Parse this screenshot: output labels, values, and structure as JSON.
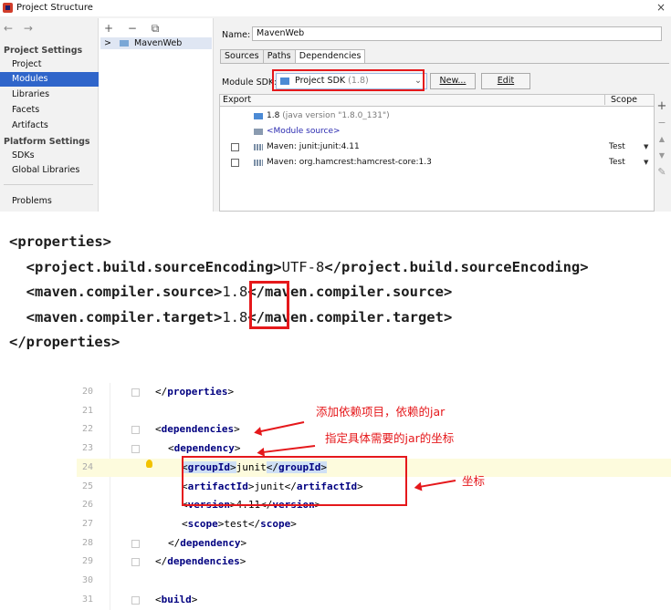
{
  "dialog": {
    "title": "Project Structure",
    "close_glyph": "×",
    "nav_arrows": "← →",
    "nav": {
      "project_settings_header": "Project Settings",
      "items_project": [
        "Project",
        "Modules",
        "Libraries",
        "Facets",
        "Artifacts"
      ],
      "platform_settings_header": "Platform Settings",
      "items_platform": [
        "SDKs",
        "Global Libraries"
      ],
      "problems": "Problems",
      "selected": "Modules"
    },
    "mid": {
      "toolbar": "+ − ⧉",
      "module_name": "MavenWeb",
      "expander": ">"
    },
    "name_label": "Name:",
    "name_value": "MavenWeb",
    "tabs": [
      "Sources",
      "Paths",
      "Dependencies"
    ],
    "active_tab": "Dependencies",
    "module_sdk_label": "Module SDK:",
    "sdk_selected": "Project SDK",
    "sdk_version": "(1.8)",
    "new_button": "New...",
    "edit_button": "Edit",
    "table": {
      "export_header": "Export",
      "scope_header": "Scope",
      "rows": [
        {
          "text_main": "1.8",
          "text_muted": "(java version \"1.8.0_131\")",
          "scope": "",
          "checkbox": false
        },
        {
          "text_main": "<Module source>",
          "text_muted": "",
          "scope": "",
          "checkbox": false
        },
        {
          "text_main": "Maven: junit:junit:4.11",
          "text_muted": "",
          "scope": "Test",
          "checkbox": true
        },
        {
          "text_main": "Maven: org.hamcrest:hamcrest-core:1.3",
          "text_muted": "",
          "scope": "Test",
          "checkbox": true
        }
      ]
    },
    "side_tools": [
      "+",
      "−",
      "▲",
      "▼",
      "✎"
    ]
  },
  "properties_snippet": {
    "l1_open": "<properties>",
    "l2_open": "<project.build.sourceEncoding>",
    "l2_text": "UTF-8",
    "l2_close": "</project.build.sourceEncoding>",
    "l3_open": "<maven.compiler.source>",
    "l3_text": "1.8",
    "l3_close": "</maven.compiler.source>",
    "l4_open": "<maven.compiler.target>",
    "l4_text": "1.8",
    "l4_close": "</maven.compiler.target>",
    "l5_close": "</properties>"
  },
  "editor": {
    "line_numbers": [
      "20",
      "21",
      "22",
      "23",
      "24",
      "25",
      "26",
      "27",
      "28",
      "29",
      "30",
      "31"
    ],
    "groupId_value": "junit",
    "artifactId_value": "junit",
    "version_value": "4.11",
    "scope_value": "test"
  },
  "annotations": {
    "add_dependency": "添加依赖项目，依赖的jar",
    "coordinates_hint": "指定具体需要的jar的坐标",
    "coordinates": "坐标"
  },
  "colors": {
    "highlight_red": "#e5181b",
    "selection_blue": "#2f65ca",
    "xml_tag": "#000080"
  }
}
